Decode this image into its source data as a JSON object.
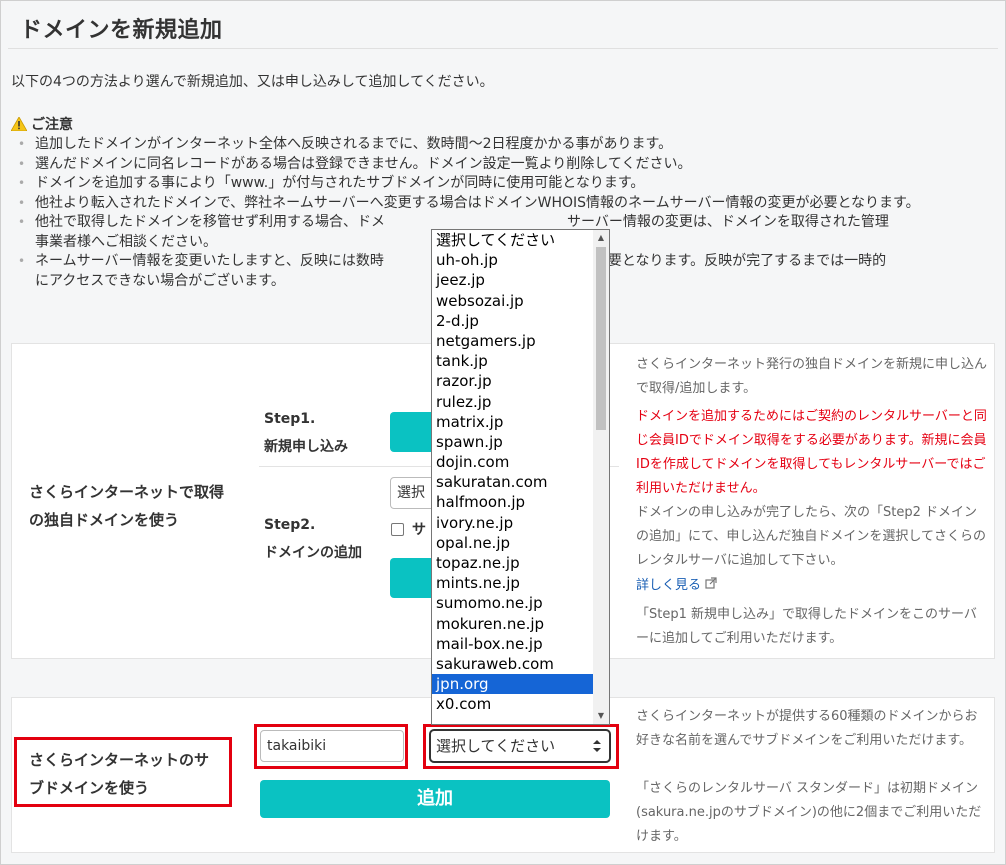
{
  "page": {
    "title": "ドメインを新規追加",
    "intro": "以下の4つの方法より選んで新規追加、又は申し込みして追加してください。"
  },
  "notes": {
    "heading": "ご注意",
    "items": [
      "追加したドメインがインターネット全体へ反映されるまでに、数時間〜2日程度かかる事があります。",
      "選んだドメインに同名レコードがある場合は登録できません。ドメイン設定一覧より削除してください。",
      "ドメインを追加する事により「www.」が付与されたサブドメインが同時に使用可能となります。",
      "他社より転入されたドメインで、弊社ネームサーバーへ変更する場合はドメインWHOIS情報のネームサーバー情報の変更が必要となります。",
      "他社で取得したドメインを移管せず利用する場合、ドメ",
      "ネームサーバー情報を変更いたしますと、反映には数時"
    ],
    "item5_tail_line1": "サーバー情報の変更は、ドメインを取得された管理",
    "item5_line2": "事業者様へご相談ください。",
    "item6_tail_line1": "間が必要となります。反映が完了するまでは一時的",
    "item6_line2": "にアクセスできない場合がございます。"
  },
  "section1": {
    "label": "さくらインターネットで取得の独自ドメインを使う",
    "step1_label": "Step1.",
    "step1_sub": "新規申し込み",
    "step2_label": "Step2.",
    "step2_sub": "ドメインの追加",
    "select_partial": "選択",
    "checkbox_partial": "サ",
    "info1": "さくらインターネット発行の独自ドメインを新規に申し込んで取得/追加します。",
    "info_red": "ドメインを追加するためにはご契約のレンタルサーバーと同じ会員IDでドメイン取得をする必要があります。新規に会員IDを作成してドメインを取得してもレンタルサーバーではご利用いただけません。",
    "info2": "ドメインの申し込みが完了したら、次の「Step2 ドメインの追加」にて、申し込んだ独自ドメインを選択してさくらのレンタルサーバに追加して下さい。",
    "link": "詳しく見る",
    "info3": "「Step1 新規申し込み」で取得したドメインをこのサーバーに追加してご利用いただけます。"
  },
  "section2": {
    "label_line1": "さくらインターネットのサ",
    "label_line2": "ブドメインを使う",
    "subdomain_value": "takaibiki",
    "select_value": "選択してください",
    "add_button": "追加",
    "info1": "さくらインターネットが提供する60種類のドメインからお好きな名前を選んでサブドメインをご利用いただけます。",
    "info2": "「さくらのレンタルサーバ スタンダード」は初期ドメイン(sakura.ne.jpのサブドメイン)の他に2個までご利用いただけます。"
  },
  "dropdown": {
    "options": [
      "選択してください",
      "uh-oh.jp",
      "jeez.jp",
      "websozai.jp",
      "2-d.jp",
      "netgamers.jp",
      "tank.jp",
      "razor.jp",
      "rulez.jp",
      "matrix.jp",
      "spawn.jp",
      "dojin.com",
      "sakuratan.com",
      "halfmoon.jp",
      "ivory.ne.jp",
      "opal.ne.jp",
      "topaz.ne.jp",
      "mints.ne.jp",
      "sumomo.ne.jp",
      "mokuren.ne.jp",
      "mail-box.ne.jp",
      "sakuraweb.com",
      "jpn.org",
      "x0.com"
    ],
    "highlighted": "jpn.org"
  },
  "colors": {
    "accent": "#0ac2c2",
    "highlight": "#e3000f",
    "selected_option": "#1565d6",
    "warning_text": "#e50012",
    "link": "#1a5fb4"
  }
}
